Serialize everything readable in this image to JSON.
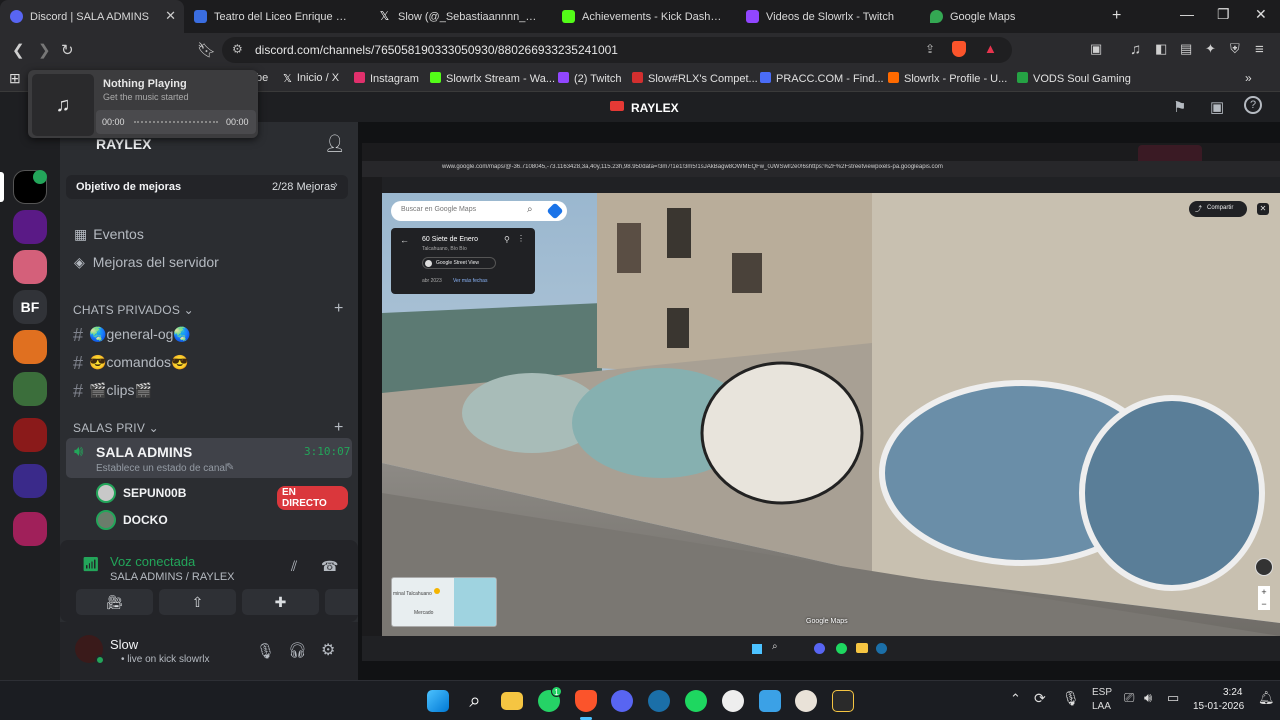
{
  "browser": {
    "tabs": [
      {
        "label": "Discord | SALA ADMINS",
        "color": "#5865f2"
      },
      {
        "label": "Teatro del Liceo Enrique Molina",
        "color": "#3a6de0"
      },
      {
        "label": "Slow (@_Sebastiaannnn_) / X",
        "color": "#000000"
      },
      {
        "label": "Achievements - Kick Dashboard",
        "color": "#53fc18"
      },
      {
        "label": "Videos de Slowrlx - Twitch",
        "color": "#9146ff"
      },
      {
        "label": "Google Maps",
        "color": "#34a853"
      }
    ],
    "url": "discord.com/channels/765058190333050930/880266933235241001",
    "bookmarks": [
      {
        "label": "be",
        "color": "#ff0000"
      },
      {
        "label": "Inicio / X",
        "color": "#000000"
      },
      {
        "label": "Instagram",
        "color": "#e1306c"
      },
      {
        "label": "Slowrlx Stream - Wa...",
        "color": "#53fc18"
      },
      {
        "label": "(2) Twitch",
        "color": "#9146ff"
      },
      {
        "label": "Slow#RLX's Compet...",
        "color": "#d32f2f"
      },
      {
        "label": "PRACC.COM - Find...",
        "color": "#4a6cf7"
      },
      {
        "label": "Slowrlx - Profile - U...",
        "color": "#ff6a00"
      },
      {
        "label": "VODS Soul Gaming",
        "color": "#25a244"
      }
    ]
  },
  "music_popup": {
    "title": "Nothing Playing",
    "subtitle": "Get the music started",
    "time_start": "00:00",
    "time_end": "00:00"
  },
  "discord": {
    "title": "RAYLEX",
    "server_name": "RAYLEX",
    "rail_badge": "BF",
    "boost_goal_label": "Objetivo de mejoras",
    "boost_goal_value": "2/28 Mejoras",
    "events": "Eventos",
    "server_boosts": "Mejoras del servidor",
    "category_private_chats": "CHATS PRIVADOS",
    "channels": [
      "general-og",
      "comandos",
      "clips"
    ],
    "channel_emojis": [
      "🌏",
      "😎",
      "🎬"
    ],
    "category_private_rooms": "SALAS PRIV",
    "voice_channel": {
      "name": "SALA ADMINS",
      "timer": "3:10:07",
      "status": "Establece un estado de canal",
      "members": [
        {
          "name": "SEPUN00B",
          "live_badge": "EN DIRECTO"
        },
        {
          "name": "DOCKO"
        }
      ]
    },
    "voice_panel": {
      "status": "Voz conectada",
      "location": "SALA ADMINS / RAYLEX"
    },
    "user": {
      "name": "Slow",
      "activity": "• live on kick slowrlx"
    }
  },
  "stream": {
    "maps": {
      "search_placeholder": "Buscar en Google Maps",
      "place_name": "60 Siete de Enero",
      "place_region": "Talcahuano, Bío Bío",
      "street_view_label": "Google Street View",
      "date_label": "abr 2023",
      "more_dates": "Ver más fechas",
      "share_label": "Compartir",
      "brand": "Google Maps",
      "minimap_text_1": "minal Talcahuano",
      "minimap_text_2": "Mercado",
      "url": "www.google.com/maps/@-36.7108045,-73.1163428,3a,40y,115.23h,98.95t/data=!3m7!1e1!3m5!1sJAkBagw8OWMEQFw_0JWSwl!2e0!6shttps:%2F%2Fstreetviewpixels-pa.googleapis.com"
    }
  },
  "taskbar": {
    "lang_top": "ESP",
    "lang_bottom": "LAA",
    "time": "3:24",
    "date": "15-01-2026",
    "whatsapp_badge": "1"
  }
}
